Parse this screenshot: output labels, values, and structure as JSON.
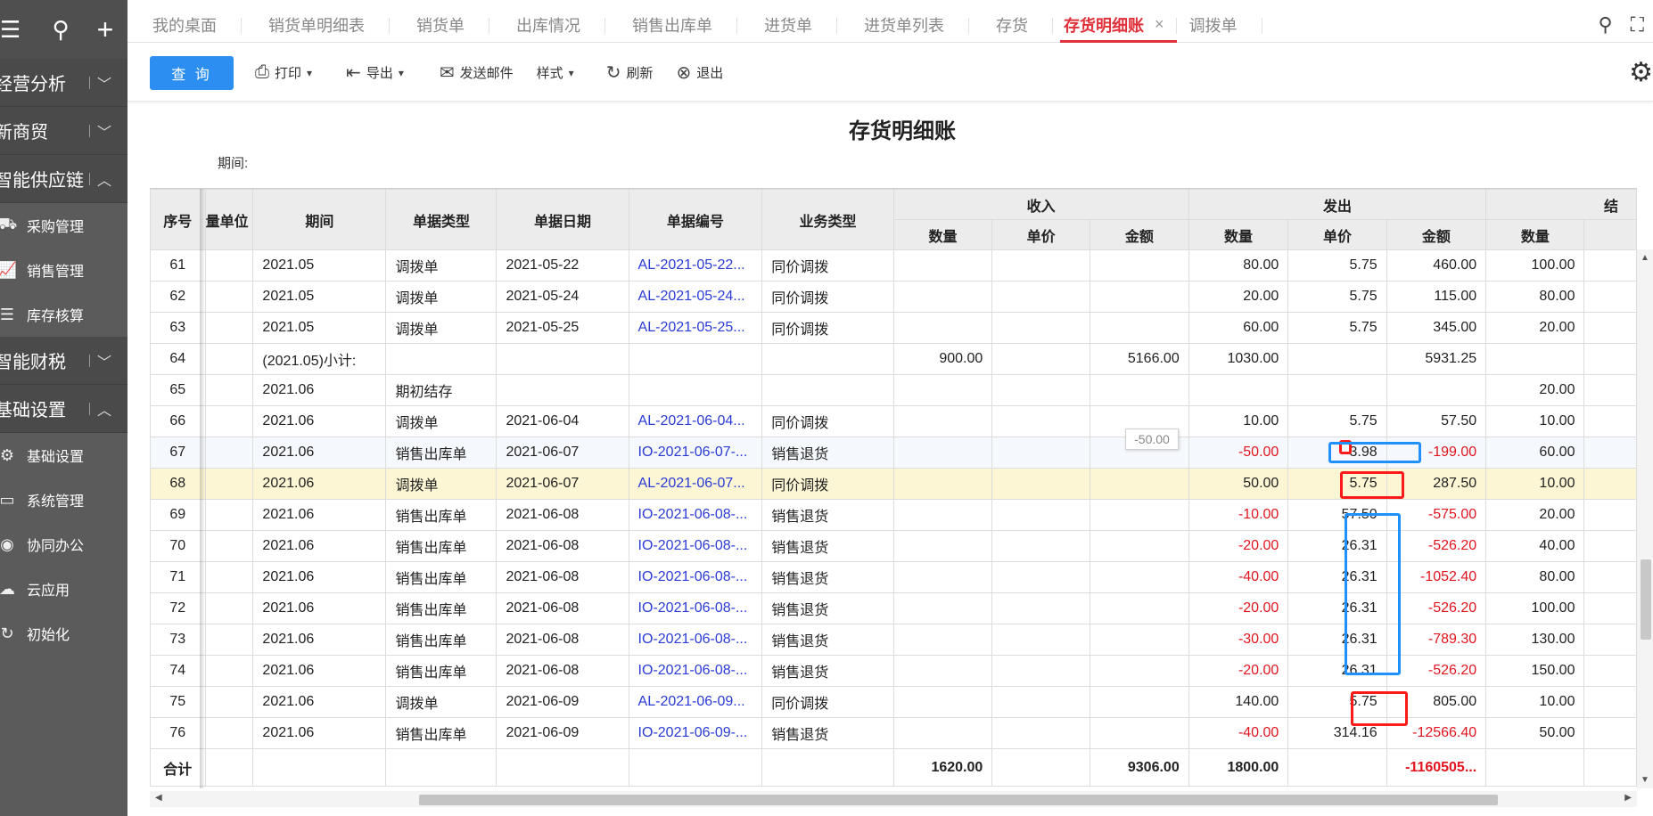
{
  "sidebar": {
    "top_icons": [
      "menu-icon",
      "search-icon",
      "plus-icon"
    ],
    "groups": [
      {
        "label": "经营分析",
        "expanded": false
      },
      {
        "label": "新商贸",
        "expanded": false
      },
      {
        "label": "智能供应链",
        "expanded": true
      },
      {
        "label": "智能财税",
        "expanded": false
      },
      {
        "label": "基础设置",
        "expanded": true
      }
    ],
    "supply_items": [
      {
        "label": "采购管理",
        "icon": "cart-icon"
      },
      {
        "label": "销售管理",
        "icon": "chart-icon"
      },
      {
        "label": "库存核算",
        "icon": "warehouse-icon"
      }
    ],
    "basic_items": [
      {
        "label": "基础设置",
        "icon": "settings-icon"
      },
      {
        "label": "系统管理",
        "icon": "monitor-icon"
      },
      {
        "label": "协同办公",
        "icon": "collab-icon"
      },
      {
        "label": "云应用",
        "icon": "cloud-icon"
      },
      {
        "label": "初始化",
        "icon": "reset-icon"
      }
    ]
  },
  "tabs": [
    {
      "label": "我的桌面",
      "active": false
    },
    {
      "label": "销货单明细表",
      "active": false
    },
    {
      "label": "销货单",
      "active": false
    },
    {
      "label": "出库情况",
      "active": false
    },
    {
      "label": "销售出库单",
      "active": false
    },
    {
      "label": "进货单",
      "active": false
    },
    {
      "label": "进货单列表",
      "active": false
    },
    {
      "label": "存货",
      "active": false
    },
    {
      "label": "存货明细账",
      "active": true
    },
    {
      "label": "调拨单",
      "active": false
    }
  ],
  "tab_close": "×",
  "toolbar": {
    "query": "查 询",
    "print": "打印",
    "export": "导出",
    "email": "发送邮件",
    "style": "样式",
    "refresh": "刷新",
    "exit": "退出"
  },
  "report": {
    "title": "存货明细账",
    "period_label": "期间:"
  },
  "headers": {
    "seq": "序号",
    "unit": "量单位",
    "period": "期间",
    "doc_type": "单据类型",
    "doc_date": "单据日期",
    "doc_no": "单据编号",
    "biz_type": "业务类型",
    "income": "收入",
    "outgo": "发出",
    "balance": "结",
    "qty": "数量",
    "price": "单价",
    "amount": "金额"
  },
  "rows": [
    {
      "seq": "61",
      "period": "2021.05",
      "type": "调拨单",
      "date": "2021-05-22",
      "no": "AL-2021-05-22...",
      "biz": "同价调拨",
      "in_qty": "",
      "in_price": "",
      "in_amt": "",
      "out_qty": "80.00",
      "out_price": "5.75",
      "out_amt": "460.00",
      "bal_qty": "100.00",
      "neg": false
    },
    {
      "seq": "62",
      "period": "2021.05",
      "type": "调拨单",
      "date": "2021-05-24",
      "no": "AL-2021-05-24...",
      "biz": "同价调拨",
      "in_qty": "",
      "in_price": "",
      "in_amt": "",
      "out_qty": "20.00",
      "out_price": "5.75",
      "out_amt": "115.00",
      "bal_qty": "80.00",
      "neg": false
    },
    {
      "seq": "63",
      "period": "2021.05",
      "type": "调拨单",
      "date": "2021-05-25",
      "no": "AL-2021-05-25...",
      "biz": "同价调拨",
      "in_qty": "",
      "in_price": "",
      "in_amt": "",
      "out_qty": "60.00",
      "out_price": "5.75",
      "out_amt": "345.00",
      "bal_qty": "20.00",
      "neg": false
    },
    {
      "seq": "64",
      "period": "(2021.05)小计:",
      "type": "",
      "date": "",
      "no": "",
      "biz": "",
      "in_qty": "900.00",
      "in_price": "",
      "in_amt": "5166.00",
      "out_qty": "1030.00",
      "out_price": "",
      "out_amt": "5931.25",
      "bal_qty": "",
      "neg": false
    },
    {
      "seq": "65",
      "period": "2021.06",
      "type": "期初结存",
      "date": "",
      "no": "",
      "biz": "",
      "in_qty": "",
      "in_price": "",
      "in_amt": "",
      "out_qty": "",
      "out_price": "",
      "out_amt": "",
      "bal_qty": "20.00",
      "neg": false
    },
    {
      "seq": "66",
      "period": "2021.06",
      "type": "调拨单",
      "date": "2021-06-04",
      "no": "AL-2021-06-04...",
      "biz": "同价调拨",
      "in_qty": "",
      "in_price": "",
      "in_amt": "",
      "out_qty": "10.00",
      "out_price": "5.75",
      "out_amt": "57.50",
      "bal_qty": "10.00",
      "neg": false
    },
    {
      "seq": "67",
      "period": "2021.06",
      "type": "销售出库单",
      "date": "2021-06-07",
      "no": "IO-2021-06-07-...",
      "biz": "销售退货",
      "in_qty": "",
      "in_price": "",
      "in_amt": "",
      "out_qty": "-50.00",
      "out_price": "3.98",
      "out_amt": "-199.00",
      "bal_qty": "60.00",
      "neg": true
    },
    {
      "seq": "68",
      "period": "2021.06",
      "type": "调拨单",
      "date": "2021-06-07",
      "no": "AL-2021-06-07...",
      "biz": "同价调拨",
      "in_qty": "",
      "in_price": "",
      "in_amt": "",
      "out_qty": "50.00",
      "out_price": "5.75",
      "out_amt": "287.50",
      "bal_qty": "10.00",
      "neg": false
    },
    {
      "seq": "69",
      "period": "2021.06",
      "type": "销售出库单",
      "date": "2021-06-08",
      "no": "IO-2021-06-08-...",
      "biz": "销售退货",
      "in_qty": "",
      "in_price": "",
      "in_amt": "",
      "out_qty": "-10.00",
      "out_price": "57.50",
      "out_amt": "-575.00",
      "bal_qty": "20.00",
      "neg": true
    },
    {
      "seq": "70",
      "period": "2021.06",
      "type": "销售出库单",
      "date": "2021-06-08",
      "no": "IO-2021-06-08-...",
      "biz": "销售退货",
      "in_qty": "",
      "in_price": "",
      "in_amt": "",
      "out_qty": "-20.00",
      "out_price": "26.31",
      "out_amt": "-526.20",
      "bal_qty": "40.00",
      "neg": true
    },
    {
      "seq": "71",
      "period": "2021.06",
      "type": "销售出库单",
      "date": "2021-06-08",
      "no": "IO-2021-06-08-...",
      "biz": "销售退货",
      "in_qty": "",
      "in_price": "",
      "in_amt": "",
      "out_qty": "-40.00",
      "out_price": "26.31",
      "out_amt": "-1052.40",
      "bal_qty": "80.00",
      "neg": true
    },
    {
      "seq": "72",
      "period": "2021.06",
      "type": "销售出库单",
      "date": "2021-06-08",
      "no": "IO-2021-06-08-...",
      "biz": "销售退货",
      "in_qty": "",
      "in_price": "",
      "in_amt": "",
      "out_qty": "-20.00",
      "out_price": "26.31",
      "out_amt": "-526.20",
      "bal_qty": "100.00",
      "neg": true
    },
    {
      "seq": "73",
      "period": "2021.06",
      "type": "销售出库单",
      "date": "2021-06-08",
      "no": "IO-2021-06-08-...",
      "biz": "销售退货",
      "in_qty": "",
      "in_price": "",
      "in_amt": "",
      "out_qty": "-30.00",
      "out_price": "26.31",
      "out_amt": "-789.30",
      "bal_qty": "130.00",
      "neg": true
    },
    {
      "seq": "74",
      "period": "2021.06",
      "type": "销售出库单",
      "date": "2021-06-08",
      "no": "IO-2021-06-08-...",
      "biz": "销售退货",
      "in_qty": "",
      "in_price": "",
      "in_amt": "",
      "out_qty": "-20.00",
      "out_price": "26.31",
      "out_amt": "-526.20",
      "bal_qty": "150.00",
      "neg": true
    },
    {
      "seq": "75",
      "period": "2021.06",
      "type": "调拨单",
      "date": "2021-06-09",
      "no": "AL-2021-06-09...",
      "biz": "同价调拨",
      "in_qty": "",
      "in_price": "",
      "in_amt": "",
      "out_qty": "140.00",
      "out_price": "5.75",
      "out_amt": "805.00",
      "bal_qty": "10.00",
      "neg": false
    },
    {
      "seq": "76",
      "period": "2021.06",
      "type": "销售出库单",
      "date": "2021-06-09",
      "no": "IO-2021-06-09-...",
      "biz": "销售退货",
      "in_qty": "",
      "in_price": "",
      "in_amt": "",
      "out_qty": "-40.00",
      "out_price": "314.16",
      "out_amt": "-12566.40",
      "bal_qty": "50.00",
      "neg": true
    }
  ],
  "totals": {
    "label": "合计",
    "in_qty": "1620.00",
    "in_amt": "9306.00",
    "out_qty": "1800.00",
    "out_amt": "-1160505..."
  },
  "tooltip_value": "-50.00",
  "colors": {
    "accent": "#2b8ef0",
    "active_tab": "#e0313b",
    "negative": "#e0151f",
    "link": "#2a3bd6",
    "highlight_row": "#fdf6d4",
    "annotation_red": "#ff1a1a",
    "annotation_blue": "#1e90ff"
  }
}
